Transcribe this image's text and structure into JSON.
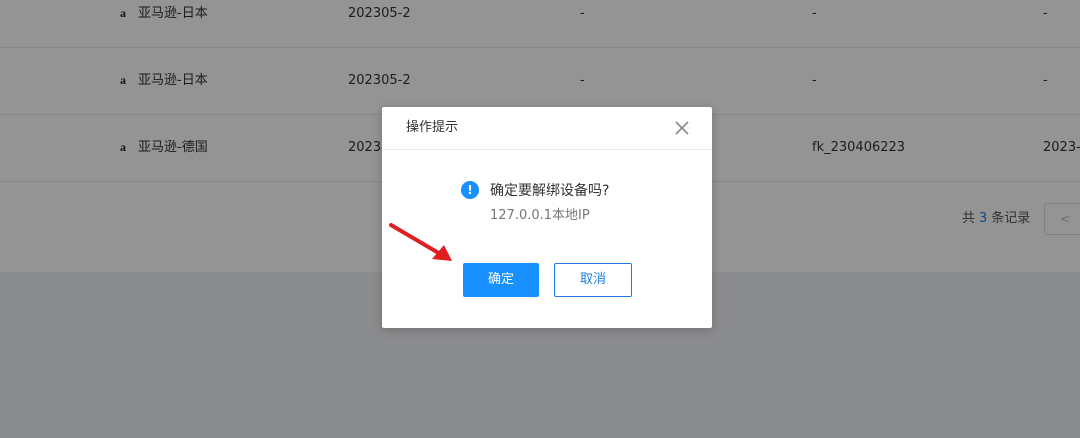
{
  "table": {
    "rows": [
      {
        "platform": "亚马逊-日本",
        "code": "202305-2",
        "col_a": "-",
        "col_b": "-",
        "col_c": "-"
      },
      {
        "platform": "亚马逊-日本",
        "code": "202305-2",
        "col_a": "-",
        "col_b": "-",
        "col_c": "-"
      },
      {
        "platform": "亚马逊-德国",
        "code": "2023-",
        "col_a": "",
        "col_b": "fk_230406223",
        "col_c": "2023-"
      }
    ],
    "platform_icon_glyph": "a"
  },
  "pagination": {
    "prefix": "共",
    "total": "3",
    "suffix": "条记录",
    "prev_label": "<"
  },
  "dialog": {
    "title": "操作提示",
    "message": "确定要解绑设备吗?",
    "detail": "127.0.0.1本地IP",
    "warn_glyph": "!",
    "confirm_label": "确定",
    "cancel_label": "取消"
  },
  "colors": {
    "primary": "#1890ff",
    "annotation_arrow": "#e02020"
  }
}
